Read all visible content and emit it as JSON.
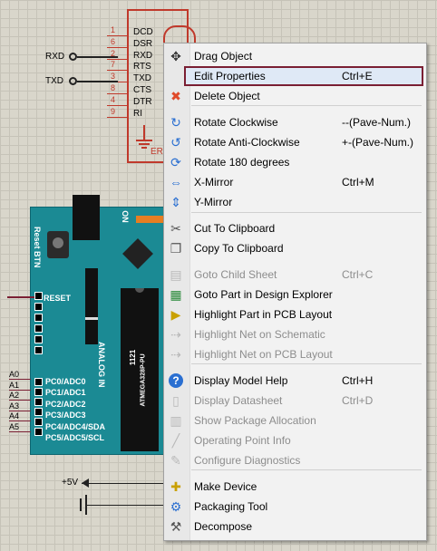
{
  "schematic": {
    "connector": {
      "pins": [
        {
          "num": "1",
          "name": "DCD"
        },
        {
          "num": "6",
          "name": "DSR"
        },
        {
          "num": "2",
          "name": "RXD"
        },
        {
          "num": "7",
          "name": "RTS"
        },
        {
          "num": "3",
          "name": "TXD"
        },
        {
          "num": "8",
          "name": "CTS"
        },
        {
          "num": "4",
          "name": "DTR"
        },
        {
          "num": "9",
          "name": "RI"
        }
      ],
      "ref_partial": "ERR"
    },
    "terminals": {
      "rxd": "RXD",
      "txd": "TXD",
      "plus5v": "+5V"
    },
    "arduino": {
      "reset_btn": "Reset BTN",
      "on": "ON",
      "reset": "RESET",
      "analog_in": "ANALOG IN",
      "chip_number": "1121",
      "chip_name": "ATMEGA328P-PU",
      "analog_pins": [
        "PC0/ADC0",
        "PC1/ADC1",
        "PC2/ADC2",
        "PC3/ADC3",
        "PC4/ADC4/SDA",
        "PC5/ADC5/SCL"
      ],
      "analog_nets": [
        "A0",
        "A1",
        "A2",
        "A3",
        "A4",
        "A5"
      ]
    }
  },
  "menu": {
    "items": [
      {
        "icon": "move-icon",
        "label": "Drag Object",
        "shortcut": ""
      },
      {
        "icon": "",
        "label": "Edit Properties",
        "shortcut": "Ctrl+E",
        "highlighted": true
      },
      {
        "icon": "delete-x-icon",
        "label": "Delete Object",
        "shortcut": ""
      },
      {
        "icon": "rotate-cw-icon",
        "label": "Rotate Clockwise",
        "shortcut": "--(Pave-Num.)"
      },
      {
        "icon": "rotate-ccw-icon",
        "label": "Rotate Anti-Clockwise",
        "shortcut": "+-(Pave-Num.)"
      },
      {
        "icon": "rotate-180-icon",
        "label": "Rotate 180 degrees",
        "shortcut": ""
      },
      {
        "icon": "x-mirror-icon",
        "label": "X-Mirror",
        "shortcut": "Ctrl+M"
      },
      {
        "icon": "y-mirror-icon",
        "label": "Y-Mirror",
        "shortcut": ""
      },
      {
        "icon": "cut-icon",
        "label": "Cut To Clipboard",
        "shortcut": ""
      },
      {
        "icon": "copy-icon",
        "label": "Copy To Clipboard",
        "shortcut": ""
      },
      {
        "icon": "child-sheet-icon",
        "label": "Goto Child Sheet",
        "shortcut": "Ctrl+C",
        "disabled": true
      },
      {
        "icon": "design-explorer-icon",
        "label": "Goto Part in Design Explorer",
        "shortcut": ""
      },
      {
        "icon": "highlight-pcb-icon",
        "label": "Highlight Part in PCB Layout",
        "shortcut": ""
      },
      {
        "icon": "net-schematic-icon",
        "label": "Highlight Net on Schematic",
        "shortcut": "",
        "disabled": true
      },
      {
        "icon": "net-pcb-icon",
        "label": "Highlight Net on PCB Layout",
        "shortcut": "",
        "disabled": true
      },
      {
        "icon": "help-icon",
        "label": "Display Model Help",
        "shortcut": "Ctrl+H"
      },
      {
        "icon": "datasheet-icon",
        "label": "Display Datasheet",
        "shortcut": "Ctrl+D",
        "disabled": true
      },
      {
        "icon": "package-icon",
        "label": "Show Package Allocation",
        "shortcut": "",
        "disabled": true
      },
      {
        "icon": "operating-point-icon",
        "label": "Operating Point Info",
        "shortcut": "",
        "disabled": true
      },
      {
        "icon": "diagnostics-icon",
        "label": "Configure Diagnostics",
        "shortcut": "",
        "disabled": true
      },
      {
        "icon": "make-device-icon",
        "label": "Make Device",
        "shortcut": ""
      },
      {
        "icon": "packaging-tool-icon",
        "label": "Packaging Tool",
        "shortcut": ""
      },
      {
        "icon": "decompose-icon",
        "label": "Decompose",
        "shortcut": ""
      }
    ]
  },
  "colors": {
    "highlight_border": "#7a1f33",
    "schematic_red": "#c0392b",
    "board": "#1b8a94",
    "icon_blue": "#2a6fd1",
    "delete_red": "#e04a2a"
  }
}
